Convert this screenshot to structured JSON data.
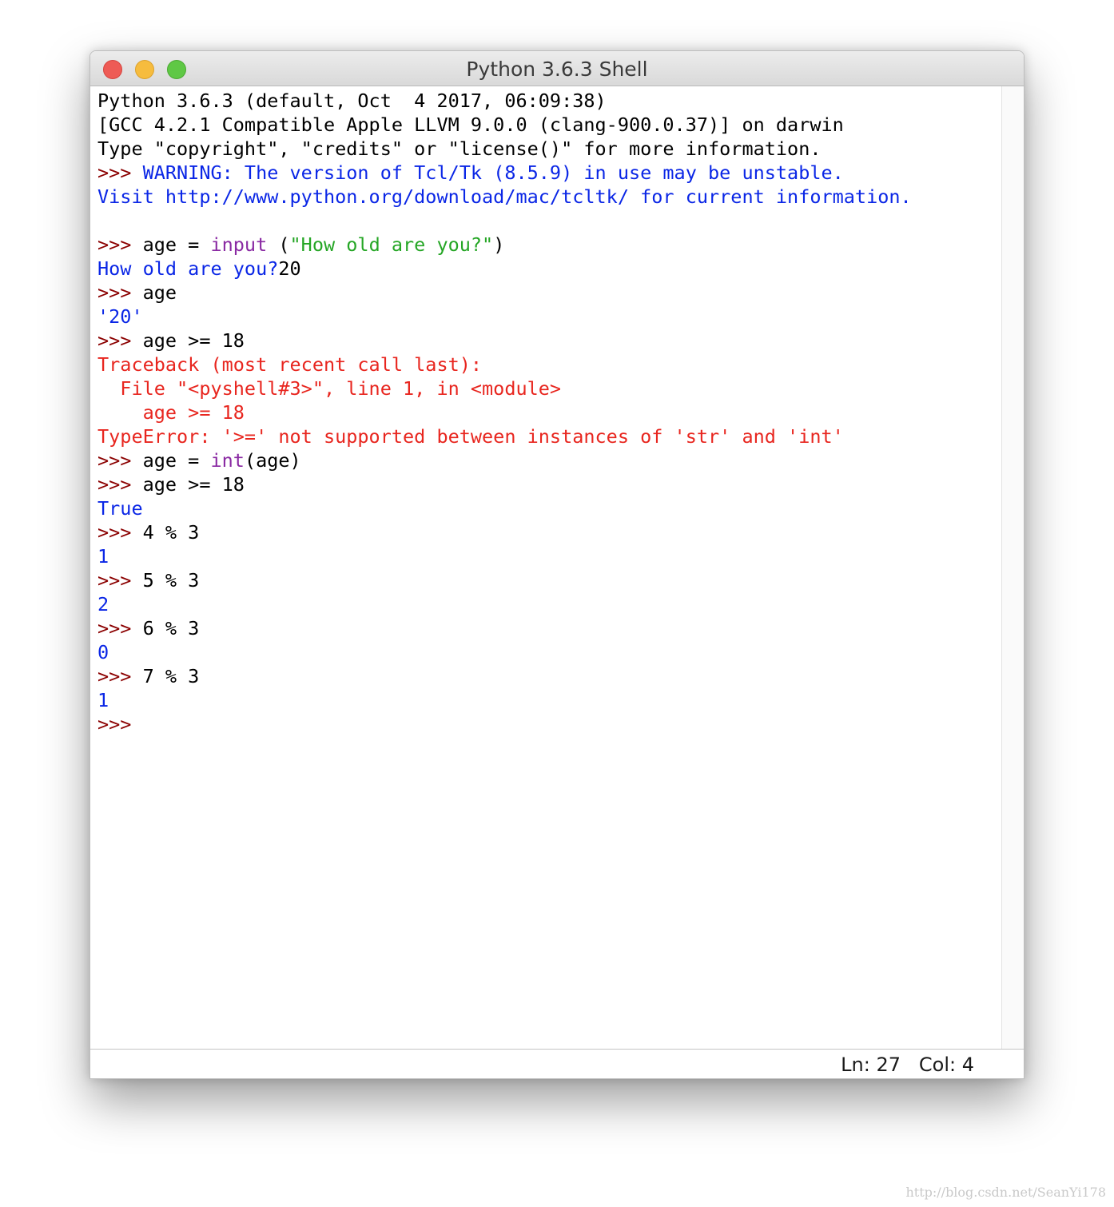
{
  "window": {
    "title": "Python 3.6.3 Shell"
  },
  "shell": {
    "banner": [
      "Python 3.6.3 (default, Oct  4 2017, 06:09:38)",
      "[GCC 4.2.1 Compatible Apple LLVM 9.0.0 (clang-900.0.37)] on darwin",
      "Type \"copyright\", \"credits\" or \"license()\" for more information."
    ],
    "prompt": ">>> ",
    "warning": {
      "line1": "WARNING: The version of Tcl/Tk (8.5.9) in use may be unstable.",
      "line2": "Visit http://www.python.org/download/mac/tcltk/ for current information."
    },
    "session": {
      "input_stmt": {
        "pre": "age = ",
        "builtin": "input",
        "mid": " (",
        "string": "\"How old are you?\"",
        "post": ")"
      },
      "input_prompt_out": "How old are you?",
      "typed_value": "20",
      "cmd_age": "age",
      "age_repr": "'20'",
      "cmd_compare": "age >= 18",
      "traceback": {
        "header": "Traceback (most recent call last):",
        "file_line": "  File \"<pyshell#3>\", line 1, in <module>",
        "code_line": "    age >= 18",
        "error": "TypeError: '>=' not supported between instances of 'str' and 'int'"
      },
      "int_stmt": {
        "pre": "age = ",
        "builtin": "int",
        "post": "(age)"
      },
      "cmd_compare2": "age >= 18",
      "result_true": "True",
      "mods": [
        {
          "expr": "4 % 3",
          "result": "1"
        },
        {
          "expr": "5 % 3",
          "result": "2"
        },
        {
          "expr": "6 % 3",
          "result": "0"
        },
        {
          "expr": "7 % 3",
          "result": "1"
        }
      ],
      "final_prompt": ">>>"
    }
  },
  "status": {
    "position": "Ln: 27   Col: 4"
  },
  "watermark": "http://blog.csdn.net/SeanYi178",
  "colors": {
    "prompt": "#8b0000",
    "output": "#0a26e6",
    "error": "#e8261f",
    "builtin": "#8a2aa3",
    "string": "#25a625"
  }
}
